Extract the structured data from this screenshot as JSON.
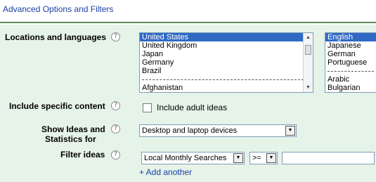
{
  "header": {
    "title": "Advanced Options and Filters"
  },
  "help_glyph": "?",
  "locations": {
    "label": "Locations and languages",
    "countries": [
      {
        "label": "United States",
        "selected": true
      },
      {
        "label": "United Kingdom",
        "selected": false
      },
      {
        "label": "Japan",
        "selected": false
      },
      {
        "label": "Germany",
        "selected": false
      },
      {
        "label": "Brazil",
        "selected": false
      },
      {
        "label": "",
        "separator": true
      },
      {
        "label": "Afghanistan",
        "selected": false
      }
    ],
    "languages": [
      {
        "label": "English",
        "selected": true
      },
      {
        "label": "Japanese",
        "selected": false
      },
      {
        "label": "German",
        "selected": false
      },
      {
        "label": "Portuguese",
        "selected": false
      },
      {
        "label": "",
        "separator": true
      },
      {
        "label": "Arabic",
        "selected": false
      },
      {
        "label": "Bulgarian",
        "selected": false
      }
    ]
  },
  "specific_content": {
    "label": "Include specific content",
    "adult_label": "Include adult ideas",
    "adult_checked": false
  },
  "show_ideas": {
    "label_line1": "Show Ideas and",
    "label_line2": "Statistics for",
    "value": "Desktop and laptop devices"
  },
  "filter_ideas": {
    "label": "Filter ideas",
    "metric": "Local Monthly Searches",
    "operator": ">=",
    "value": "",
    "add_label": "+ Add another"
  },
  "colors": {
    "panel": "#e6f3e9",
    "link": "#1a3fa5",
    "header_rule": "#5a8a5a",
    "selection": "#316ac5"
  },
  "icons": [
    "help-icon",
    "dropdown-arrow-icon",
    "scroll-up-icon",
    "scroll-down-icon"
  ]
}
